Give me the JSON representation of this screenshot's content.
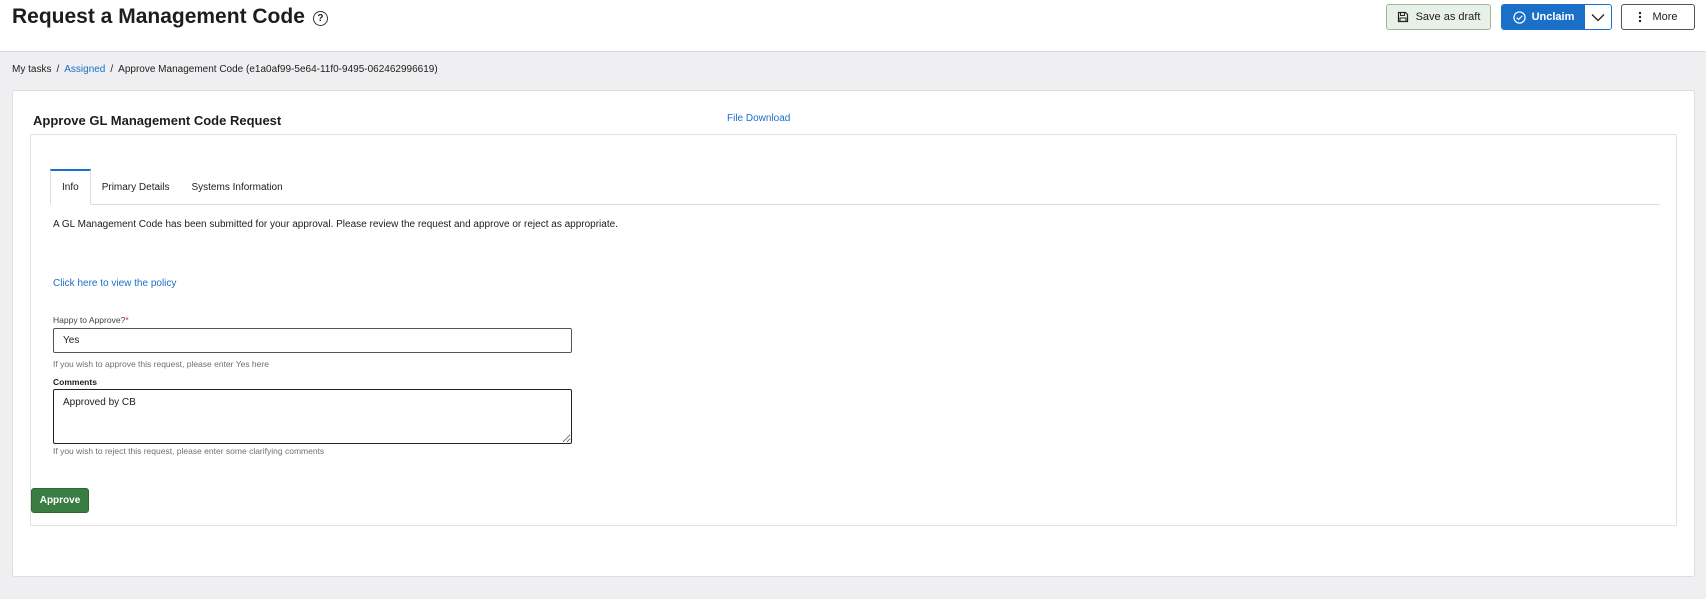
{
  "header": {
    "title": "Request a Management Code",
    "help_icon": "question-circle-icon",
    "save_draft_label": "Save as draft",
    "unclaim_label": "Unclaim",
    "more_label": "More"
  },
  "breadcrumb": {
    "items": [
      "My tasks",
      "Assigned",
      "Approve Management Code (e1a0af99-5e64-11f0-9495-062462996619)"
    ],
    "separator": "/"
  },
  "card": {
    "section_title": "Approve GL Management Code Request",
    "file_download": "File Download",
    "tabs": [
      {
        "label": "Info",
        "active": true
      },
      {
        "label": "Primary Details",
        "active": false
      },
      {
        "label": "Systems Information",
        "active": false
      }
    ],
    "info_text": "A GL Management Code has been submitted for your approval. Please review the request and approve or reject as appropriate.",
    "policy_link": "Click here to view the policy",
    "approve_field": {
      "label": "Happy to Approve?",
      "required_marker": "*",
      "value": "Yes",
      "help": "If you wish to approve this request, please enter Yes here"
    },
    "comments_field": {
      "label": "Comments",
      "value": "Approved by CB",
      "help": "If you wish to reject this request, please enter some clarifying comments"
    },
    "approve_button": "Approve"
  },
  "colors": {
    "accent": "#1a6fc9",
    "approve": "#3a7d43",
    "draft_bg": "#e7f1e7"
  }
}
